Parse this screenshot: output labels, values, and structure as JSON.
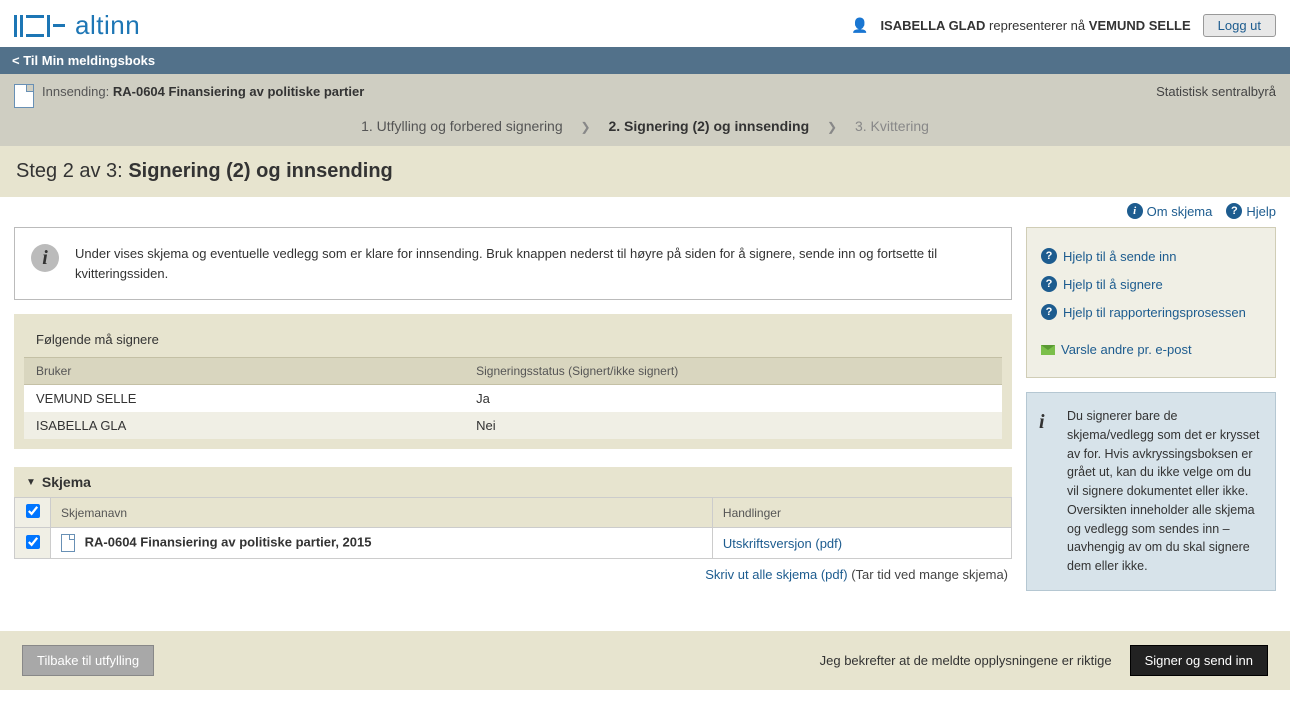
{
  "brand": "altinn",
  "user": {
    "name": "ISABELLA GLAD",
    "middle": "representerer nå",
    "represents": "VEMUND SELLE"
  },
  "logout": "Logg ut",
  "back_link": "< Til Min meldingsboks",
  "submission": {
    "label": "Innsending:",
    "title": "RA-0604 Finansiering av politiske partier",
    "agency": "Statistisk sentralbyrå"
  },
  "steps": {
    "s1": "1. Utfylling og forbered signering",
    "s2": "2. Signering (2) og innsending",
    "s3": "3. Kvittering"
  },
  "step_title": {
    "prefix": "Steg 2 av 3:",
    "main": "Signering (2) og innsending"
  },
  "header_links": {
    "about": "Om skjema",
    "help": "Hjelp"
  },
  "info_text": "Under vises skjema og eventuelle vedlegg som er klare for innsending. Bruk knappen nederst til høyre på siden for å signere, sende inn og fortsette til kvitteringssiden.",
  "sign_panel": {
    "title": "Følgende må signere",
    "col_user": "Bruker",
    "col_status": "Signeringsstatus (Signert/ikke signert)",
    "rows": [
      {
        "user": "VEMUND SELLE",
        "status": "Ja"
      },
      {
        "user": "ISABELLA GLA",
        "status": "Nei"
      }
    ]
  },
  "skjema": {
    "header": "Skjema",
    "col_name": "Skjemanavn",
    "col_actions": "Handlinger",
    "row_name": "RA-0604 Finansiering av politiske partier, 2015",
    "row_action": "Utskriftsversjon (pdf)"
  },
  "print_all": {
    "link": "Skriv ut alle skjema (pdf)",
    "note": "(Tar tid ved mange skjema)"
  },
  "side_links": {
    "l1": "Hjelp til å sende inn",
    "l2": "Hjelp til å signere",
    "l3": "Hjelp til rapporteringsprosessen",
    "l4": "Varsle andre pr. e-post"
  },
  "side_info": "Du signerer bare de skjema/vedlegg som det er krysset av for. Hvis avkryssingsboksen er grået ut, kan du ikke velge om du vil signere dokumentet eller ikke. Oversikten inneholder alle skjema og vedlegg som sendes inn – uavhengig av om du skal signere dem eller ikke.",
  "footer": {
    "back": "Tilbake til utfylling",
    "confirm": "Jeg bekrefter at de meldte opplysningene er riktige",
    "sign": "Signer og send inn"
  }
}
